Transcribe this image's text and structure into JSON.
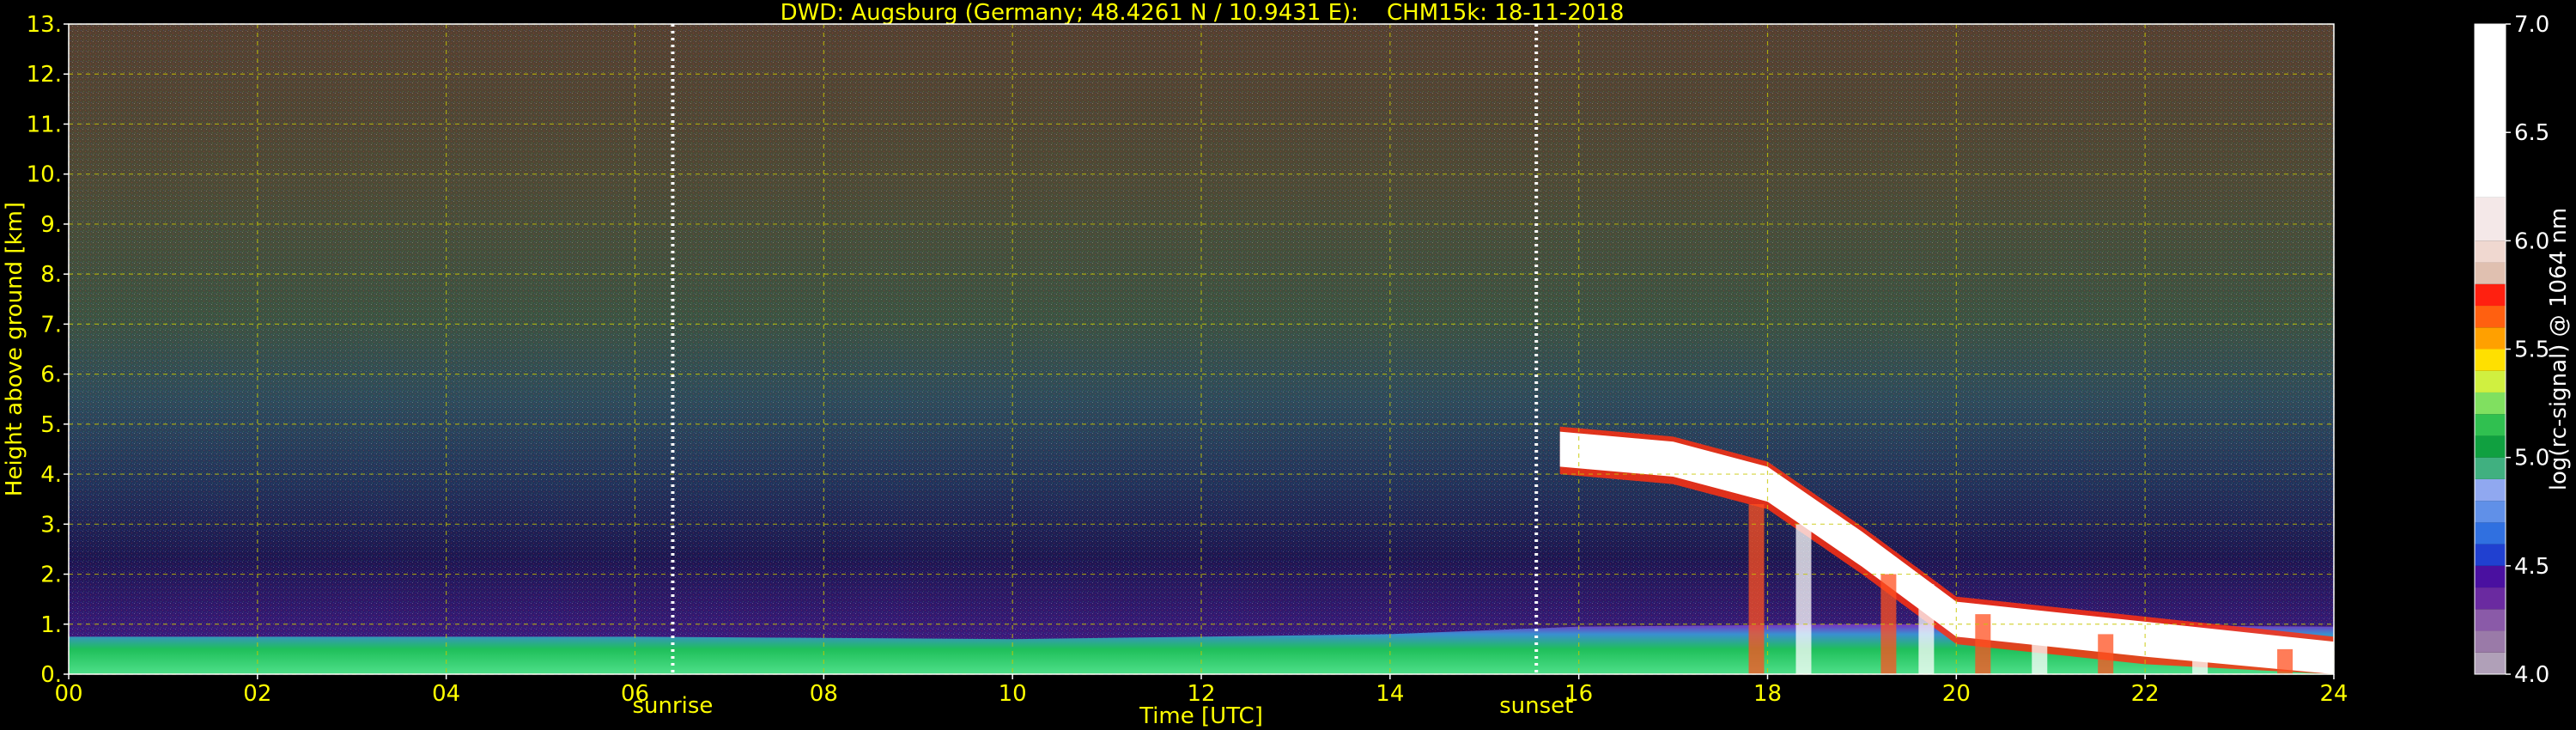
{
  "title": "DWD: Augsburg (Germany; 48.4261 N / 10.9431 E):    CHM15k: 18-11-2018",
  "chart_data": {
    "type": "heatmap",
    "title": "DWD: Augsburg (Germany; 48.4261 N / 10.9431 E):    CHM15k: 18-11-2018",
    "xlabel": "Time [UTC]",
    "ylabel": "Height above ground [km]",
    "xlim": [
      0,
      24
    ],
    "ylim": [
      0,
      13
    ],
    "x_ticks": [
      "00",
      "02",
      "04",
      "06",
      "08",
      "10",
      "12",
      "14",
      "16",
      "18",
      "20",
      "22",
      "24"
    ],
    "y_ticks": [
      "0.",
      "1.",
      "2.",
      "3.",
      "4.",
      "5.",
      "6.",
      "7.",
      "8.",
      "9.",
      "10.",
      "11.",
      "12.",
      "13."
    ],
    "grid": true,
    "annotations": [
      {
        "label": "sunrise",
        "time": 6.4
      },
      {
        "label": "sunset",
        "time": 15.55
      }
    ],
    "colorbar": {
      "label": "log(rc-signal) @ 1064 nm",
      "range": [
        4.0,
        7.0
      ],
      "ticks": [
        "4.0",
        "4.5",
        "5.0",
        "5.5",
        "6.0",
        "6.5",
        "7.0"
      ]
    },
    "layers": {
      "boundary_layer_top_km": [
        [
          0,
          0.75
        ],
        [
          6,
          0.75
        ],
        [
          10,
          0.7
        ],
        [
          14,
          0.8
        ],
        [
          16,
          0.95
        ],
        [
          19,
          1.0
        ],
        [
          24,
          0.95
        ]
      ],
      "cloud_layer_km": [
        [
          15.8,
          4.6
        ],
        [
          17,
          4.4
        ],
        [
          18,
          3.9
        ],
        [
          19,
          2.6
        ],
        [
          20,
          1.2
        ],
        [
          22,
          0.8
        ],
        [
          24,
          0.4
        ]
      ]
    }
  }
}
